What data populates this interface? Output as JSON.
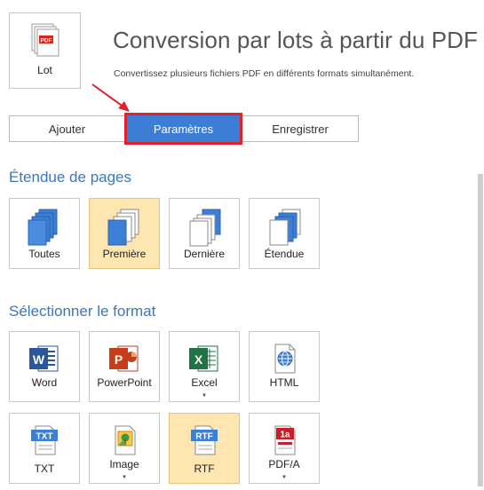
{
  "header": {
    "lot_label": "Lot",
    "title": "Conversion par lots à partir du PDF",
    "subtitle": "Convertissez plusieurs fichiers PDF en différents formats simultanément."
  },
  "tabs": [
    {
      "label": "Ajouter"
    },
    {
      "label": "Paramètres"
    },
    {
      "label": "Enregistrer"
    }
  ],
  "page_range": {
    "heading": "Étendue de pages",
    "options": [
      {
        "label": "Toutes",
        "icon": "all-pages-icon"
      },
      {
        "label": "Première",
        "icon": "first-page-icon",
        "selected": true
      },
      {
        "label": "Dernière",
        "icon": "last-page-icon"
      },
      {
        "label": "Étendue",
        "icon": "page-range-icon"
      }
    ]
  },
  "format": {
    "heading": "Sélectionner le format",
    "options": [
      {
        "label": "Word",
        "icon": "word-icon"
      },
      {
        "label": "PowerPoint",
        "icon": "powerpoint-icon"
      },
      {
        "label": "Excel",
        "icon": "excel-icon",
        "dropdown": true
      },
      {
        "label": "HTML",
        "icon": "html-icon"
      },
      {
        "label": "TXT",
        "icon": "txt-icon",
        "badge": "TXT"
      },
      {
        "label": "Image",
        "icon": "image-icon",
        "dropdown": true
      },
      {
        "label": "RTF",
        "icon": "rtf-icon",
        "badge": "RTF",
        "selected": true
      },
      {
        "label": "PDF/A",
        "icon": "pdfa-icon",
        "badge": "1a",
        "dropdown": true
      }
    ]
  },
  "colors": {
    "accent": "#3c7ed5",
    "heading": "#3b78b9",
    "selected_bg": "#fde6b0",
    "highlight": "#e0202a"
  }
}
